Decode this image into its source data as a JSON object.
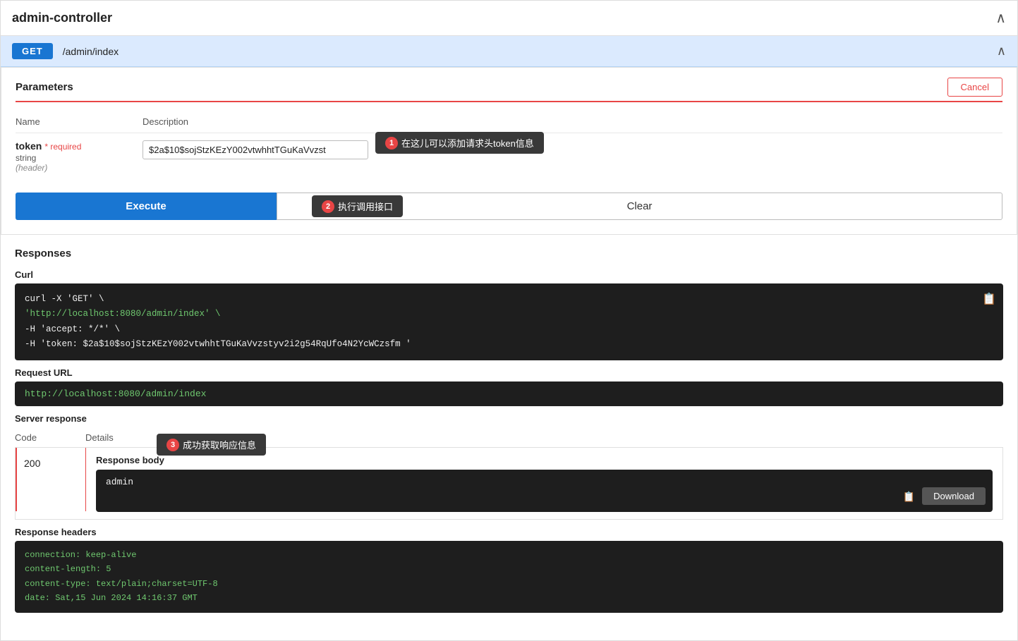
{
  "titleBar": {
    "title": "admin-controller",
    "collapseIcon": "∧"
  },
  "endpoint": {
    "method": "GET",
    "path": "/admin/index",
    "chevronIcon": "∧"
  },
  "parameters": {
    "sectionTitle": "Parameters",
    "cancelLabel": "Cancel",
    "nameCol": "Name",
    "descriptionCol": "Description",
    "tokenParam": {
      "name": "token",
      "required": "* required",
      "type": "string",
      "location": "(header)",
      "value": "$2a$10$sojStzKEzY002vtwhhtTGuKaVvzst"
    },
    "tooltip1": {
      "badge": "1",
      "text": "在这儿可以添加请求头token信息"
    }
  },
  "actions": {
    "executeLabel": "Execute",
    "clearLabel": "Clear",
    "tooltip2": {
      "badge": "2",
      "text": "执行调用接口"
    }
  },
  "responses": {
    "sectionTitle": "Responses",
    "curl": {
      "label": "Curl",
      "line1": "curl -X 'GET' \\",
      "line2": "  'http://localhost:8080/admin/index' \\",
      "line3": "  -H 'accept: */*' \\",
      "line4": "  -H 'token: $2a$10$sojStzKEzY002vtwhhtTGuKaVvzstyv2i2g54RqUfo4N2YcWCzsfm '"
    },
    "requestUrl": {
      "label": "Request URL",
      "url": "http://localhost:8080/admin/index"
    },
    "serverResponse": {
      "label": "Server response",
      "codeHeader": "Code",
      "detailsHeader": "Details",
      "code": "200",
      "responseBodyLabel": "Response body",
      "responseBodyValue": "admin",
      "downloadLabel": "Download",
      "tooltip3": {
        "badge": "3",
        "text": "成功获取响应信息"
      }
    },
    "responseHeaders": {
      "label": "Response headers",
      "lines": [
        "connection: keep-alive",
        "content-length: 5",
        "content-type: text/plain;charset=UTF-8",
        "date: Sat,15 Jun 2024 14:16:37 GMT"
      ]
    }
  }
}
